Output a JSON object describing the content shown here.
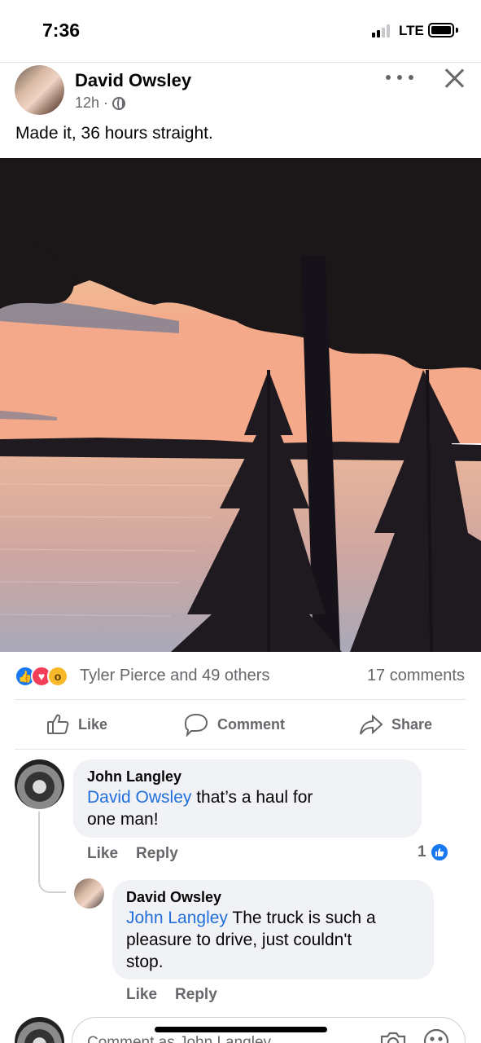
{
  "status_bar": {
    "time": "7:36",
    "network": "LTE",
    "signal_bars_filled": 2,
    "signal_bars_total": 4,
    "battery_level": 1.0
  },
  "post": {
    "author": "David Owsley",
    "timestamp": "12h ·",
    "privacy_icon": "globe-icon",
    "text": "Made it, 36 hours straight.",
    "photo_icon": "sunset-lake-trees-photo",
    "reactions": {
      "types": [
        "like",
        "love",
        "wow"
      ],
      "summary": "Tyler Pierce and 49 others",
      "comment_count": "17 comments"
    },
    "actions": {
      "like": "Like",
      "comment": "Comment",
      "share": "Share"
    }
  },
  "comments": [
    {
      "author": "John Langley",
      "mention": "David Owsley",
      "line1_rest": " that’s a haul for",
      "line2": "one man!",
      "like_label": "Like",
      "reply_label": "Reply",
      "like_count": "1"
    },
    {
      "author": "David Owsley",
      "mention": "John Langley",
      "line1_rest": " The truck is such a",
      "line2": "pleasure to drive, just couldn't",
      "line3": "stop.",
      "like_label": "Like",
      "reply_label": "Reply"
    }
  ],
  "composer": {
    "placeholder": "Comment as John Langley"
  },
  "colors": {
    "accent": "#1877f2",
    "mention": "#216fdb",
    "secondary_text": "#65676b",
    "bubble": "#f0f2f5"
  }
}
